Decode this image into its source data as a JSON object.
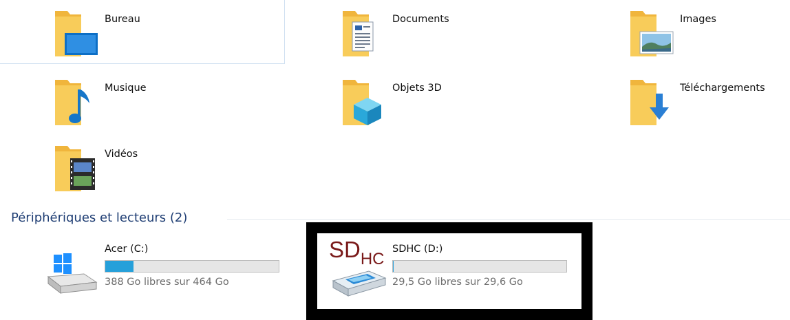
{
  "folders": [
    {
      "label": "Bureau",
      "icon": "desktop-folder-icon"
    },
    {
      "label": "Documents",
      "icon": "documents-folder-icon"
    },
    {
      "label": "Images",
      "icon": "pictures-folder-icon"
    },
    {
      "label": "Musique",
      "icon": "music-folder-icon"
    },
    {
      "label": "Objets 3D",
      "icon": "3d-objects-folder-icon"
    },
    {
      "label": "Téléchargements",
      "icon": "downloads-folder-icon"
    },
    {
      "label": "Vidéos",
      "icon": "videos-folder-icon"
    }
  ],
  "devices_section": {
    "title": "Périphériques et lecteurs (2)"
  },
  "drives": [
    {
      "name": "Acer (C:)",
      "free_text": "388 Go libres sur 464 Go",
      "used_fraction": 0.164,
      "icon": "windows-drive-icon"
    },
    {
      "name": "SDHC (D:)",
      "free_text": "29,5 Go libres sur 29,6 Go",
      "used_fraction": 0.003,
      "icon": "sd-card-drive-icon",
      "logo_text": "SD",
      "logo_sub": "HC"
    }
  ],
  "colors": {
    "folder": "#f5c04a",
    "accent": "#26a0da",
    "section_title": "#1e3d73",
    "sd_logo": "#7a1a1a"
  }
}
